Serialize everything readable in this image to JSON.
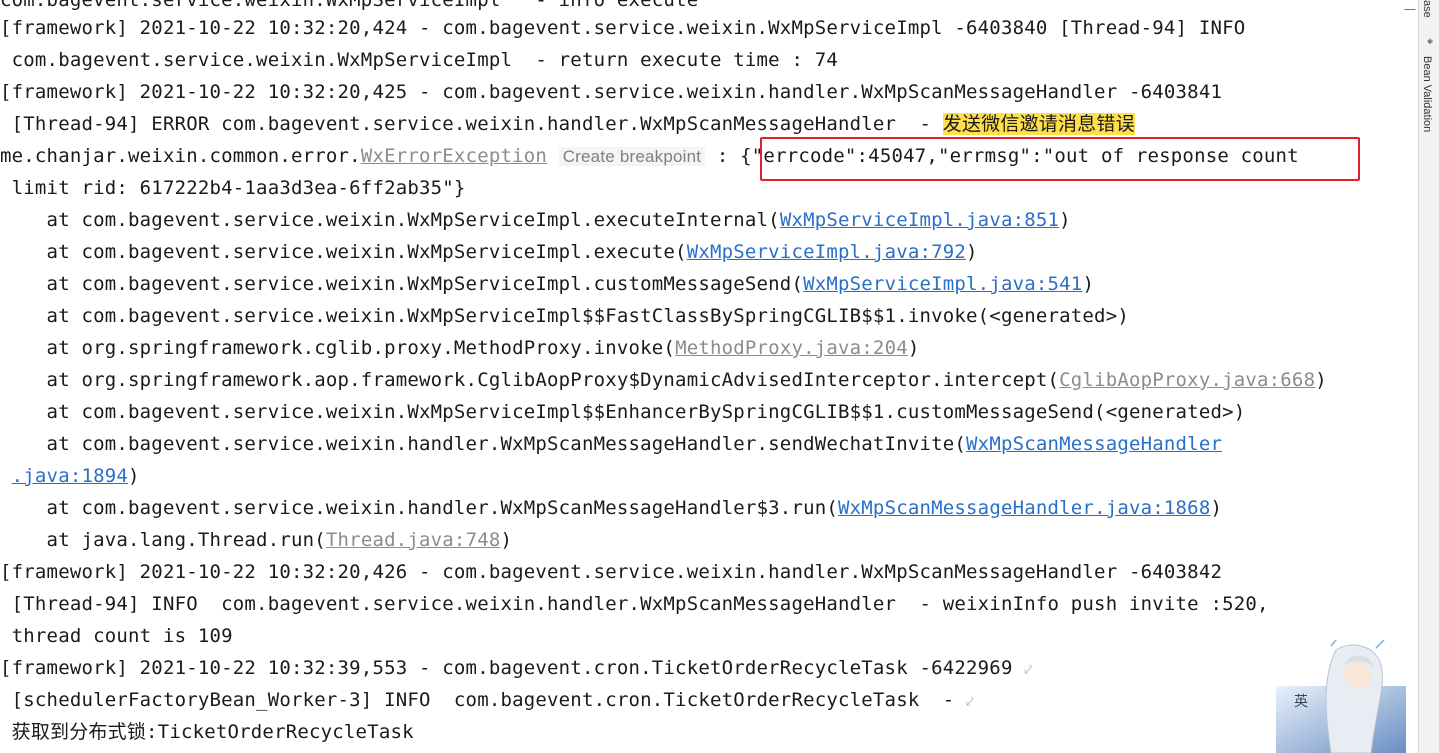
{
  "right_panel": {
    "top_label": "ase",
    "bean_validation_label": "Bean Validation"
  },
  "console": {
    "line0": "com.bagevent.service.weixin.WxMpServiceImpl   - info execute",
    "line1": "[framework] 2021-10-22 10:32:20,424 - com.bagevent.service.weixin.WxMpServiceImpl -6403840 [Thread-94] INFO",
    "line2": " com.bagevent.service.weixin.WxMpServiceImpl  - return execute time : 74",
    "line3": "[framework] 2021-10-22 10:32:20,425 - com.bagevent.service.weixin.handler.WxMpScanMessageHandler -6403841",
    "line4_prefix": " [Thread-94] ERROR com.bagevent.service.weixin.handler.WxMpScanMessageHandler  - ",
    "line4_highlight": "发送微信邀请消息错误",
    "line5_prefix": "me.chanjar.weixin.common.error.",
    "line5_exception": "WxErrorException",
    "line5_hint": "Create breakpoint",
    "line5_colon": " : ",
    "line5_msg": "{\"errcode\":45047,\"errmsg\":\"out of response count",
    "line6": " limit rid: 617222b4-1aa3d3ea-6ff2ab35\"}",
    "trace": [
      {
        "prefix": "    at com.bagevent.service.weixin.WxMpServiceImpl.executeInternal(",
        "link": "WxMpServiceImpl.java:851",
        "suffix": ")"
      },
      {
        "prefix": "    at com.bagevent.service.weixin.WxMpServiceImpl.execute(",
        "link": "WxMpServiceImpl.java:792",
        "suffix": ")"
      },
      {
        "prefix": "    at com.bagevent.service.weixin.WxMpServiceImpl.customMessageSend(",
        "link": "WxMpServiceImpl.java:541",
        "suffix": ")"
      },
      {
        "text": "    at com.bagevent.service.weixin.WxMpServiceImpl$$FastClassBySpringCGLIB$$1.invoke(<generated>)"
      },
      {
        "prefix": "    at org.springframework.cglib.proxy.MethodProxy.invoke(",
        "link": "MethodProxy.java:204",
        "suffix": ")"
      },
      {
        "prefix": "    at org.springframework.aop.framework.CglibAopProxy$DynamicAdvisedInterceptor.intercept(",
        "link": "CglibAopProxy.java:668",
        "suffix": ")"
      },
      {
        "text": "    at com.bagevent.service.weixin.WxMpServiceImpl$$EnhancerBySpringCGLIB$$1.customMessageSend(<generated>)"
      },
      {
        "prefix": "    at com.bagevent.service.weixin.handler.WxMpScanMessageHandler.sendWechatInvite(",
        "link": "WxMpScanMessageHandler",
        "suffix": ""
      },
      {
        "prefix": " ",
        "link": ".java:1894",
        "suffix": ")"
      },
      {
        "prefix": "    at com.bagevent.service.weixin.handler.WxMpScanMessageHandler$3.run(",
        "link": "WxMpScanMessageHandler.java:1868",
        "suffix": ")"
      },
      {
        "prefix": "    at java.lang.Thread.run(",
        "link": "Thread.java:748",
        "suffix": ")"
      }
    ],
    "line18": "[framework] 2021-10-22 10:32:20,426 - com.bagevent.service.weixin.handler.WxMpScanMessageHandler -6403842",
    "line19": " [Thread-94] INFO  com.bagevent.service.weixin.handler.WxMpScanMessageHandler  - weixinInfo push invite :520,",
    "line20": " thread count is 109",
    "line21": "[framework] 2021-10-22 10:32:39,553 - com.bagevent.cron.TicketOrderRecycleTask -6422969",
    "line22": " [schedulerFactoryBean_Worker-3] INFO  com.bagevent.cron.TicketOrderRecycleTask  -",
    "line23": " 获取到分布式锁:TicketOrderRecycleTask"
  },
  "colors": {
    "link": "#2a6fc9",
    "library_link": "#8c8c8c",
    "highlight": "#ffe04a",
    "annotation_box": "#e0202a"
  }
}
